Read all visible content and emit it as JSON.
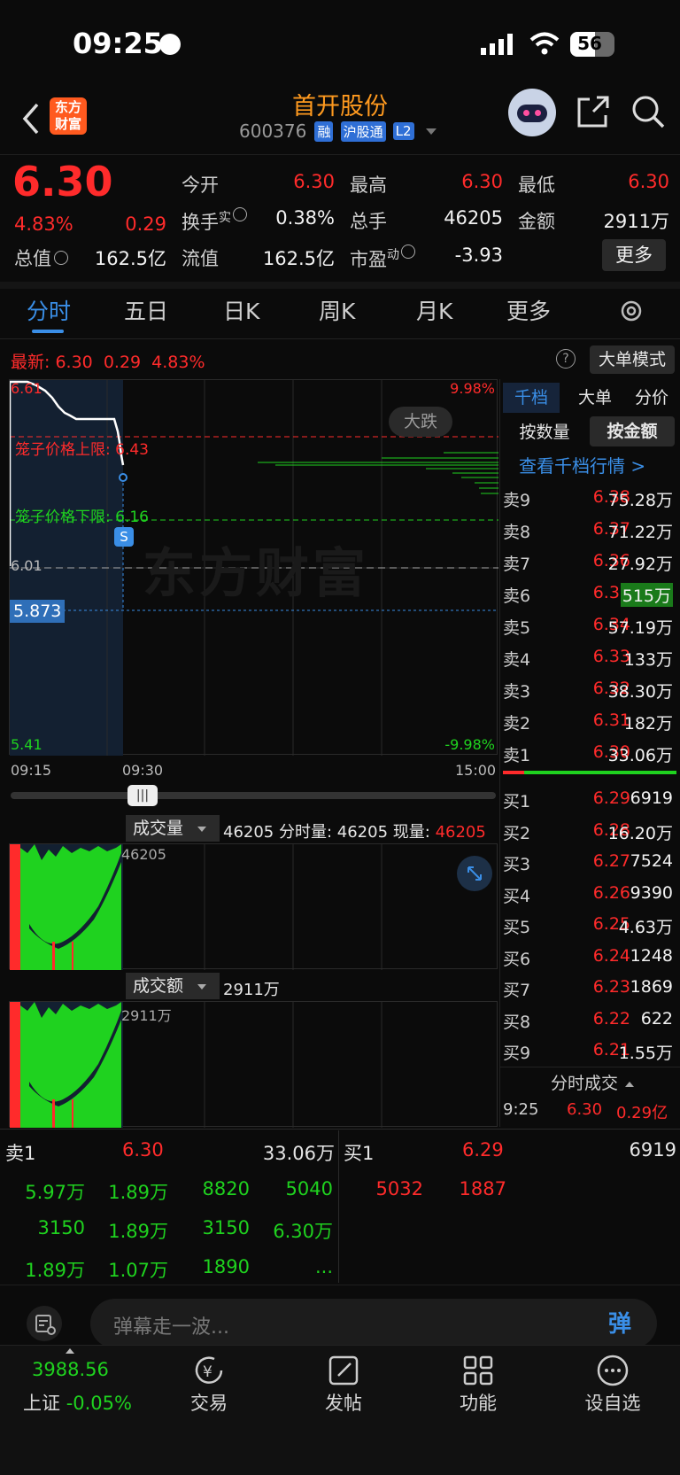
{
  "status": {
    "time": "09:25",
    "battery": "56"
  },
  "header": {
    "brand_line1": "东方",
    "brand_line2": "财富",
    "title": "首开股份",
    "code": "600376",
    "tags": [
      "融",
      "沪股通",
      "L2"
    ]
  },
  "quote": {
    "price": "6.30",
    "pct": "4.83%",
    "chg": "0.29",
    "today_open_label": "今开",
    "today_open": "6.30",
    "high_label": "最高",
    "high": "6.30",
    "low_label": "最低",
    "low": "6.30",
    "turnover_label": "换手",
    "turnover_sup": "实",
    "turnover": "0.38%",
    "volume_label": "总手",
    "volume": "46205",
    "amount_label": "金额",
    "amount": "2911万",
    "mktcap_label": "总值",
    "mktcap": "162.5亿",
    "float_label": "流值",
    "float_cap": "162.5亿",
    "pe_label": "市盈",
    "pe_sup": "动",
    "pe": "-3.93",
    "more_button": "更多"
  },
  "tabs": [
    "分时",
    "五日",
    "日K",
    "周K",
    "月K",
    "更多"
  ],
  "latest": {
    "label": "最新:",
    "price": "6.30",
    "chg": "0.29",
    "pct": "4.83%",
    "big_order_button": "大单模式"
  },
  "intraday": {
    "price_top": "6.61",
    "price_mid": "6.01",
    "price_bottom": "5.41",
    "pct_top": "9.98%",
    "pct_bottom": "-9.98%",
    "cage_upper": "笼子价格上限: 6.43",
    "cage_lower": "笼子价格下限: 6.16",
    "crosshair": "5.873",
    "big_drop": "大跌",
    "s_marker": "S",
    "watermark": "东方财富",
    "times": [
      "09:15",
      "09:30",
      "15:00"
    ]
  },
  "volume_panel": {
    "selector": "成交量",
    "readout": "46205 分时量: 46205 现量:",
    "readout_red": "46205",
    "axis": "46205"
  },
  "amount_panel": {
    "selector": "成交额",
    "readout": "2911万",
    "axis": "2911万"
  },
  "orderbook": {
    "tabs": [
      "千档",
      "大单",
      "分价"
    ],
    "modes": [
      "按数量",
      "按金额"
    ],
    "link": "查看千档行情 >",
    "asks": [
      {
        "k": "卖9",
        "p": "6.38",
        "v": "75.28万"
      },
      {
        "k": "卖8",
        "p": "6.37",
        "v": "71.22万"
      },
      {
        "k": "卖7",
        "p": "6.36",
        "v": "27.92万"
      },
      {
        "k": "卖6",
        "p": "6.35",
        "v": "515万"
      },
      {
        "k": "卖5",
        "p": "6.34",
        "v": "57.19万"
      },
      {
        "k": "卖4",
        "p": "6.33",
        "v": "133万"
      },
      {
        "k": "卖3",
        "p": "6.32",
        "v": "38.30万"
      },
      {
        "k": "卖2",
        "p": "6.31",
        "v": "182万"
      },
      {
        "k": "卖1",
        "p": "6.30",
        "v": "33.06万"
      }
    ],
    "bids": [
      {
        "k": "买1",
        "p": "6.29",
        "v": "6919"
      },
      {
        "k": "买2",
        "p": "6.28",
        "v": "16.20万"
      },
      {
        "k": "买3",
        "p": "6.27",
        "v": "7524"
      },
      {
        "k": "买4",
        "p": "6.26",
        "v": "9390"
      },
      {
        "k": "买5",
        "p": "6.25",
        "v": "4.63万"
      },
      {
        "k": "买6",
        "p": "6.24",
        "v": "1248"
      },
      {
        "k": "买7",
        "p": "6.23",
        "v": "1869"
      },
      {
        "k": "买8",
        "p": "6.22",
        "v": "622"
      },
      {
        "k": "买9",
        "p": "6.21",
        "v": "1.55万"
      }
    ],
    "ticks_label": "分时成交",
    "tick": {
      "time": "9:25",
      "price": "6.30",
      "amount": "0.29亿"
    }
  },
  "queue": {
    "sell_label": "卖1",
    "sell_price": "6.30",
    "sell_total": "33.06万",
    "buy_label": "买1",
    "buy_price": "6.29",
    "buy_total": "6919",
    "sell_orders": [
      "5.97万",
      "1.89万",
      "8820",
      "5040",
      "3150",
      "1.89万",
      "3150",
      "6.30万",
      "1.89万",
      "1.07万",
      "1890",
      "..."
    ],
    "buy_orders": [
      "5032",
      "1887"
    ]
  },
  "danmu": {
    "placeholder": "弹幕走一波...",
    "button": "弹"
  },
  "nav": {
    "index_value": "3988.56",
    "index_name": "上证",
    "index_pct": "-0.05%",
    "items": [
      "交易",
      "发帖",
      "功能",
      "设自选"
    ]
  }
}
